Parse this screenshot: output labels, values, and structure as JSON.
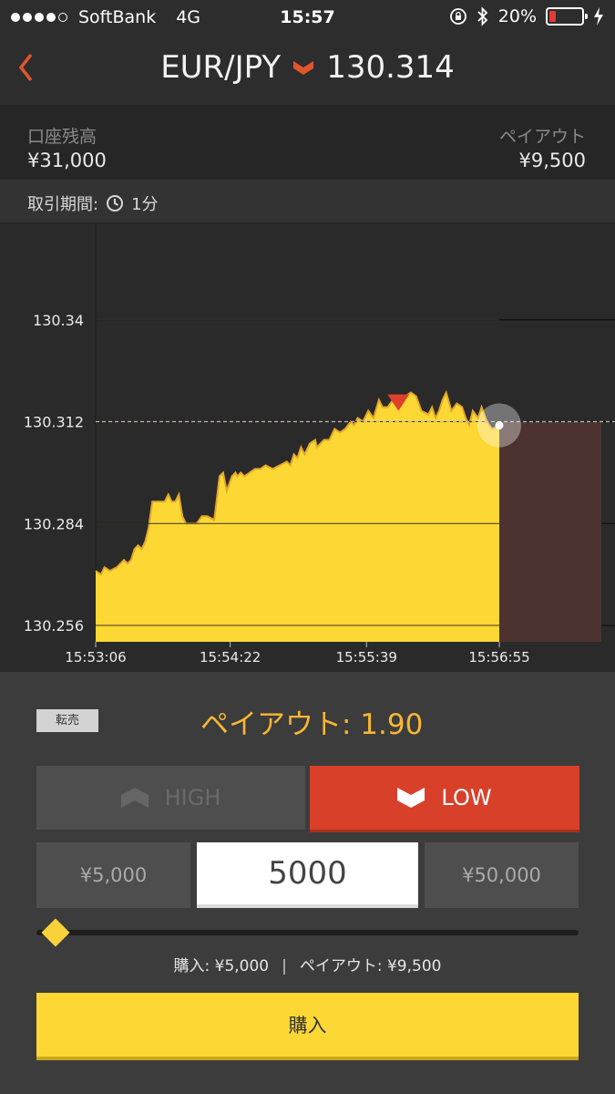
{
  "status_bar": {
    "carrier": "SoftBank",
    "network": "4G",
    "time": "15:57",
    "battery": "20%",
    "battery_level": 0.2
  },
  "header": {
    "pair": "EUR/JPY",
    "rate": "130.314",
    "direction": "down"
  },
  "account": {
    "balance_label": "口座残高",
    "balance_value": "¥31,000",
    "payout_label": "ペイアウト",
    "payout_value": "¥9,500"
  },
  "period": {
    "label": "取引期間:",
    "value": "1分"
  },
  "chart_data": {
    "type": "area",
    "x_ticks": [
      "15:53:06",
      "15:54:22",
      "15:55:39",
      "15:56:55"
    ],
    "y_ticks": [
      130.256,
      130.284,
      130.312,
      130.34
    ],
    "ylim": [
      130.2515,
      130.3665
    ],
    "grid": true,
    "strike": 130.312,
    "entry_marker": {
      "t": 171,
      "value": 130.318
    },
    "series": [
      {
        "t": [
          0,
          3,
          5,
          8,
          12,
          16,
          18,
          20,
          22,
          24,
          26,
          28,
          30,
          32,
          35,
          37,
          39,
          41,
          43,
          45,
          47,
          49,
          51,
          53,
          55,
          57,
          60,
          63,
          67,
          70,
          72,
          74,
          77,
          79,
          80,
          82,
          84,
          87,
          90,
          93,
          96,
          100,
          104,
          108,
          110,
          112,
          114,
          116,
          118,
          121,
          124,
          125,
          127,
          129,
          132,
          133,
          135,
          138,
          141,
          144,
          146,
          148,
          151,
          154,
          157,
          160,
          162,
          165,
          168,
          170,
          172,
          175,
          178,
          181,
          184,
          188,
          190,
          192,
          194,
          196,
          198,
          201,
          204,
          207,
          209,
          211,
          213,
          216,
          218,
          221,
          224,
          228
        ],
        "values": [
          130.271,
          130.27,
          130.272,
          130.271,
          130.272,
          130.274,
          130.273,
          130.274,
          130.277,
          130.278,
          130.277,
          130.279,
          130.283,
          130.29,
          130.29,
          130.29,
          130.29,
          130.292,
          130.29,
          130.29,
          130.292,
          130.286,
          130.284,
          130.284,
          130.284,
          130.284,
          130.286,
          130.286,
          130.285,
          130.297,
          130.298,
          130.293,
          130.297,
          130.298,
          130.297,
          130.298,
          130.297,
          130.298,
          130.299,
          130.299,
          130.3,
          130.299,
          130.3,
          130.301,
          130.3,
          130.303,
          130.302,
          130.305,
          130.303,
          130.306,
          130.307,
          130.305,
          130.306,
          130.307,
          130.307,
          130.308,
          130.31,
          130.309,
          130.31,
          130.312,
          130.311,
          130.313,
          130.312,
          130.315,
          130.313,
          130.318,
          130.316,
          130.316,
          130.318,
          130.317,
          130.317,
          130.319,
          130.32,
          130.319,
          130.315,
          130.314,
          130.316,
          130.313,
          130.315,
          130.318,
          130.32,
          130.315,
          130.317,
          130.316,
          130.313,
          130.311,
          130.315,
          130.313,
          130.316,
          130.312,
          130.31,
          130.311
        ]
      }
    ]
  },
  "panel": {
    "resell_label": "転売",
    "payout_rate": "ペイアウト: 1.90",
    "high_label": "HIGH",
    "low_label": "LOW",
    "amount_min": "¥5,000",
    "amount_value": "5000",
    "amount_max": "¥50,000",
    "slider_fraction": 0.0,
    "summary_purchase": "購入: ¥5,000",
    "summary_payout": "ペイアウト: ¥9,500",
    "buy_label": "購入"
  },
  "colors": {
    "accent_orange": "#e0552b",
    "low_red": "#d8402a",
    "area_yellow": "#fdd835",
    "payout_text": "#f7b733"
  }
}
